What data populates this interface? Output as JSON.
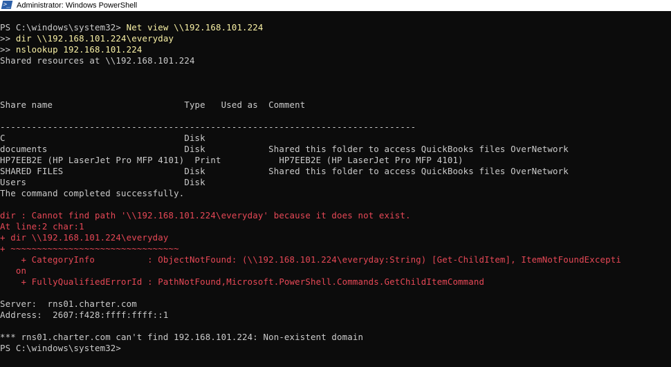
{
  "window": {
    "title": "Administrator: Windows PowerShell",
    "icon": "powershell-icon"
  },
  "colors": {
    "background": "#0c0c0c",
    "text": "#cccccc",
    "command": "#f9f1a5",
    "error": "#e74856"
  },
  "console": {
    "prompt1": "PS C:\\windows\\system32> ",
    "cmd1": "Net view \\\\192.168.101.224",
    "cont2": ">> ",
    "cmd2": "dir \\\\192.168.101.224\\everyday",
    "cont3": ">> ",
    "cmd3": "nslookup 192.168.101.224",
    "shared_header": "Shared resources at \\\\192.168.101.224",
    "table_header": "Share name                         Type   Used as  Comment",
    "separator": "-------------------------------------------------------------------------------",
    "shares": [
      {
        "line": "C                                  Disk"
      },
      {
        "line": "documents                          Disk            Shared this folder to access QuickBooks files OverNetwork"
      },
      {
        "line": "HP7EEB2E (HP LaserJet Pro MFP 4101)  Print           HP7EEB2E (HP LaserJet Pro MFP 4101)"
      },
      {
        "line": "SHARED FILES                       Disk            Shared this folder to access QuickBooks files OverNetwork"
      },
      {
        "line": "Users                              Disk"
      }
    ],
    "completed": "The command completed successfully.",
    "error_lines": [
      "dir : Cannot find path '\\\\192.168.101.224\\everyday' because it does not exist.",
      "At line:2 char:1",
      "+ dir \\\\192.168.101.224\\everyday",
      "+ ~~~~~~~~~~~~~~~~~~~~~~~~~~~~~~~~",
      "    + CategoryInfo          : ObjectNotFound: (\\\\192.168.101.224\\everyday:String) [Get-ChildItem], ItemNotFoundExcepti",
      "   on",
      "    + FullyQualifiedErrorId : PathNotFound,Microsoft.PowerShell.Commands.GetChildItemCommand"
    ],
    "server_line": "Server:  rns01.charter.com",
    "address_line": "Address:  2607:f428:ffff:ffff::1",
    "nx_line": "*** rns01.charter.com can't find 192.168.101.224: Non-existent domain",
    "final_prompt": "PS C:\\windows\\system32> "
  }
}
